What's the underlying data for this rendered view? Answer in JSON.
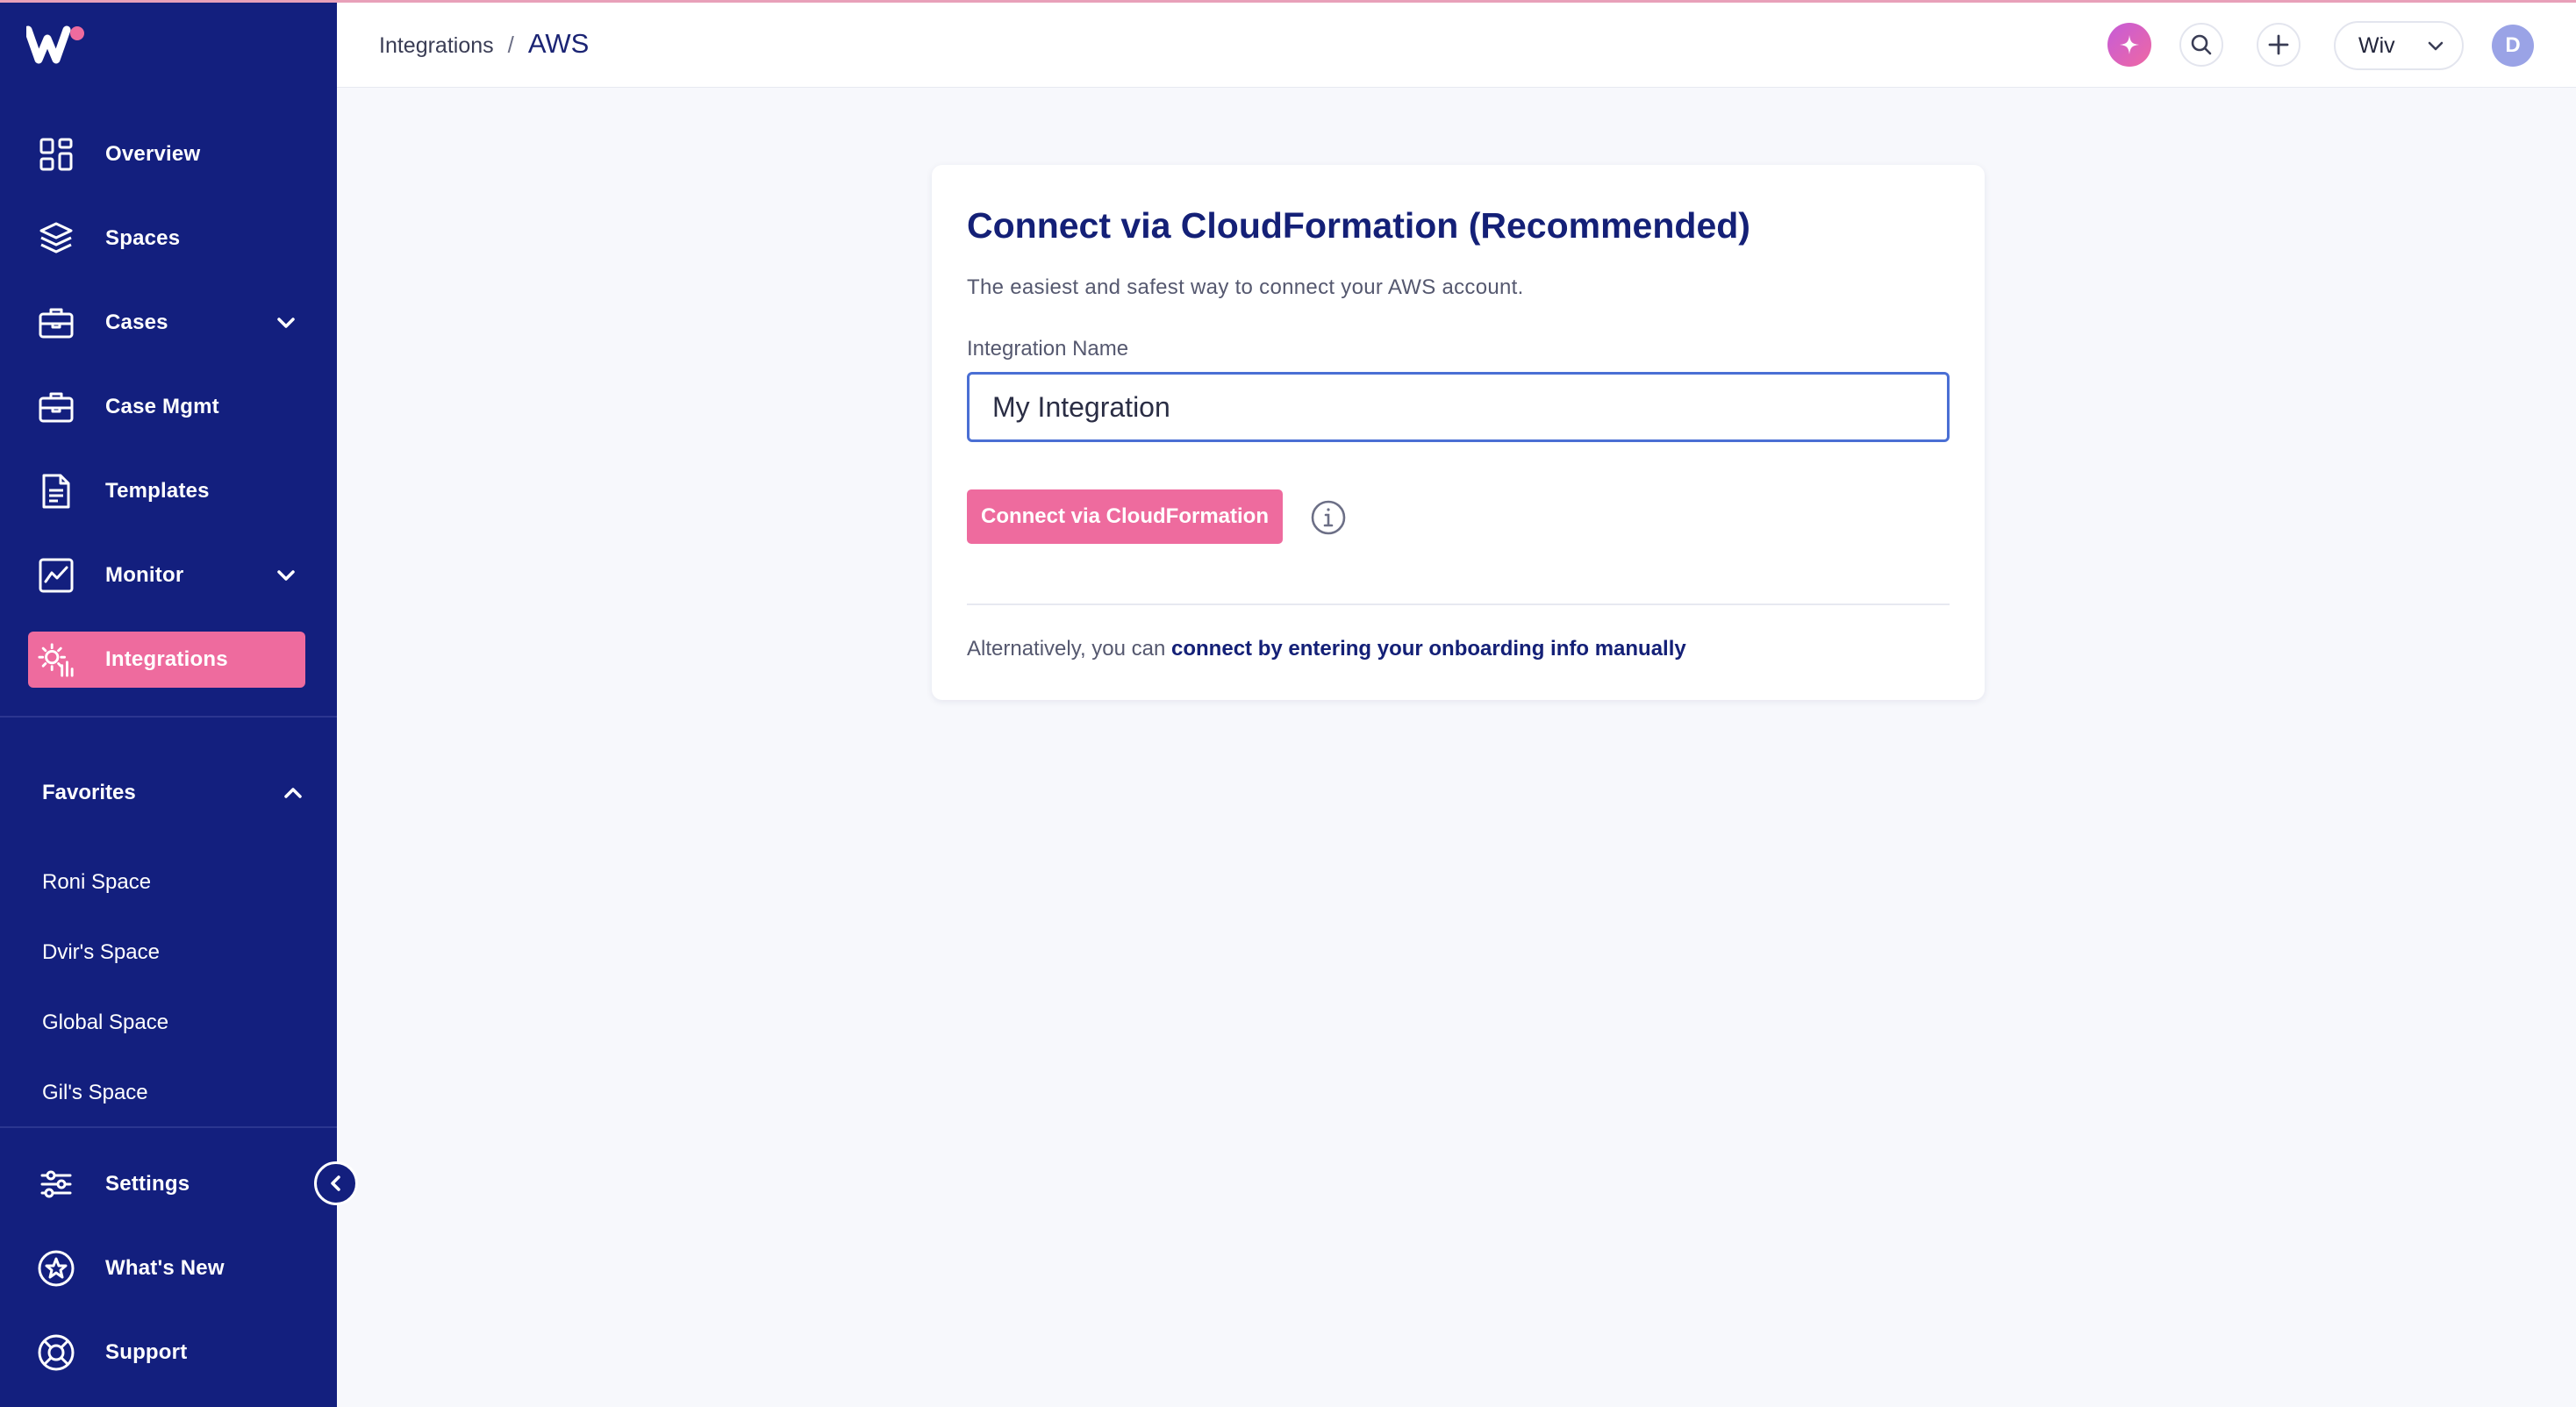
{
  "colors": {
    "sidebar_bg": "#131f7e",
    "accent_pink": "#ee6b9e",
    "title_navy": "#142077",
    "input_border": "#4a6fd4",
    "avatar_bg": "#9aa3e6"
  },
  "sidebar": {
    "items": [
      {
        "label": "Overview",
        "icon": "grid-icon"
      },
      {
        "label": "Spaces",
        "icon": "layers-icon"
      },
      {
        "label": "Cases",
        "icon": "briefcase-icon",
        "expandable": true
      },
      {
        "label": "Case Mgmt",
        "icon": "briefcase-icon"
      },
      {
        "label": "Templates",
        "icon": "document-icon"
      },
      {
        "label": "Monitor",
        "icon": "chart-monitor-icon",
        "expandable": true
      },
      {
        "label": "Integrations",
        "icon": "puzzle-gear-icon",
        "active": true
      }
    ],
    "favorites": {
      "label": "Favorites",
      "items": [
        "Roni Space",
        "Dvir's Space",
        "Global Space",
        "Gil's Space"
      ]
    },
    "bottom_items": [
      {
        "label": "Settings",
        "icon": "sliders-icon"
      },
      {
        "label": "What's New",
        "icon": "star-circle-icon"
      },
      {
        "label": "Support",
        "icon": "lifebuoy-icon"
      }
    ]
  },
  "header": {
    "breadcrumb": {
      "parent": "Integrations",
      "separator": "/",
      "current": "AWS"
    },
    "org": "Wiv",
    "avatar_initial": "D"
  },
  "card": {
    "title": "Connect via CloudFormation (Recommended)",
    "subtitle": "The easiest and safest way to connect your AWS account.",
    "field_label": "Integration Name",
    "field_value": "My Integration",
    "primary_button": "Connect via CloudFormation",
    "alt_prefix": "Alternatively, you can ",
    "alt_link": "connect by entering your onboarding info manually"
  }
}
